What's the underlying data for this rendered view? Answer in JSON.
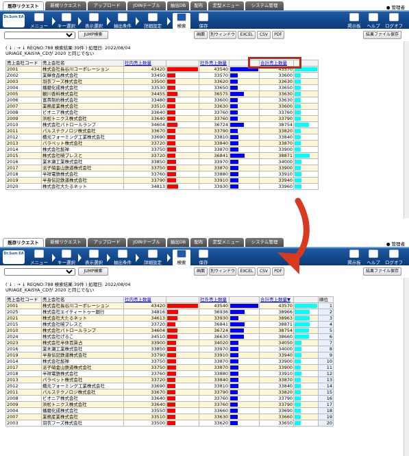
{
  "tabs": [
    "既存リクエスト",
    "新規リクエスト",
    "アップロード",
    "JOINテーブル",
    "抽出DB",
    "配布",
    "定型メニュー",
    "システム管理"
  ],
  "user": "管理者",
  "logo": "Dr.Sum EA",
  "toolbar": {
    "menu": "メニュー",
    "key_select": "キー選択",
    "display_select": "表示選択",
    "extract": "抽出条件",
    "detail": "詳細設定",
    "search": "検索",
    "save": "保存",
    "board": "掲示板",
    "help": "ヘルプ",
    "logoff": "ログオフ"
  },
  "buttons": {
    "jump": "JUMP検索",
    "screen": "画面",
    "new_window": "別ウィンドウ",
    "excel": "EXCEL",
    "csv": "CSV",
    "pdf": "PDF",
    "save_settings": "結果ファイル保存"
  },
  "panel1": {
    "info1": "( ↓ : → ↓ REQNO:788 検索結果:39件 ) 処理日: 2022/08/04",
    "info2": "URIAGE_KAISYA_CDが 2020 と同じでない",
    "headers": [
      "売上会社コード",
      "売上会社名",
      "社内売上数量",
      "",
      "社外売上数量",
      "",
      "合計売上数量",
      ""
    ],
    "rows": [
      [
        "2001",
        "株式会社長谷川コーポレーション",
        "43420",
        "43540",
        "43570"
      ],
      [
        "Z002",
        "業輝食品株式会社",
        "33450",
        "33570",
        "33600"
      ],
      [
        "2003",
        "羽衣フーズ株式会社",
        "33500",
        "33620",
        "33630"
      ],
      [
        "2004",
        "播磨化成株式会社",
        "33530",
        "33650",
        "33650"
      ],
      [
        "2005",
        "観川香料株式会社",
        "34455",
        "36575",
        "33630"
      ],
      [
        "2006",
        "富貴制約株式会社",
        "33480",
        "33600",
        "33630"
      ],
      [
        "2007",
        "業務産業株式会社",
        "33510",
        "33630",
        "33600"
      ],
      [
        "2008",
        "ビオニア株式会社",
        "33640",
        "33760",
        "33760"
      ],
      [
        "2009",
        "浜松トニクス株式会社",
        "33640",
        "33760",
        "33790"
      ],
      [
        "2010",
        "株式会社パトロールランプ",
        "34604",
        "36724",
        "38754"
      ],
      [
        "2011",
        "パルステクノロジ株式会社",
        "33670",
        "33790",
        "33820"
      ],
      [
        "2012",
        "橋元フォーミング工業株式会社",
        "33690",
        "33810",
        "33840"
      ],
      [
        "2013",
        "パラペット株式会社",
        "33720",
        "33840",
        "33870"
      ],
      [
        "2014",
        "株式会社髭禅",
        "33750",
        "33870",
        "33900"
      ],
      [
        "2015",
        "株式会社暁プレスと",
        "33720",
        "36841",
        "38871"
      ],
      [
        "2016",
        "業木瀬工業株式会社",
        "33850",
        "33970",
        "34000"
      ],
      [
        "2017",
        "派子硝金山鉄道株式会社",
        "33750",
        "33870",
        "33900"
      ],
      [
        "2018",
        "半祥電鉄株式会社",
        "33760",
        "33880",
        "33910"
      ],
      [
        "2019",
        "半身伝記鉄道株式会社",
        "33790",
        "33910",
        "33940"
      ],
      [
        "2020",
        "株式会社大たるネット",
        "34813",
        "33930",
        "33960"
      ]
    ]
  },
  "panel2": {
    "info1": "( ↓ : → ↓ REQNO:788 検索結果:39件 ) 処理日: 2022/08/04",
    "info2": "URIAGE_KAISYA_CDが 2020 と同じでない",
    "headers": [
      "売上会社コード",
      "売上会社名",
      "社内売上数量",
      "",
      "社外売上数量",
      "",
      "合計売上数量▼",
      "",
      "順位"
    ],
    "rows": [
      [
        "2001",
        "株式会社長谷川コーポレーション",
        "43420",
        "43540",
        "43570",
        "1"
      ],
      [
        "2025",
        "株式会社エイティートゥー銀行",
        "34816",
        "36936",
        "38966",
        "2"
      ],
      [
        "2021",
        "株式会社大たるネット",
        "34613",
        "33930",
        "38963",
        "3"
      ],
      [
        "2015",
        "株式会社暁プレスと",
        "33720",
        "36841",
        "38871",
        "4"
      ],
      [
        "2010",
        "株式会社パトロールランプ",
        "34604",
        "36724",
        "38754",
        "5"
      ],
      [
        "2024",
        "株式会社げるこ",
        "34510",
        "36630",
        "38660",
        "6"
      ],
      [
        "2023",
        "株式会社半休百貨占",
        "33900",
        "34020",
        "34050",
        "7"
      ],
      [
        "2016",
        "業木瀬工業株式会社",
        "33850",
        "33970",
        "34000",
        "8"
      ],
      [
        "2019",
        "半身伝記鉄道株式会社",
        "33790",
        "33910",
        "33940",
        "9"
      ],
      [
        "2014",
        "株式会社髭禅",
        "33750",
        "33870",
        "33900",
        "10"
      ],
      [
        "2017",
        "派子硝金山鉄道株式会社",
        "33750",
        "33870",
        "33900",
        "11"
      ],
      [
        "2018",
        "半祥電鉄株式会社",
        "33760",
        "33880",
        "33910",
        "12"
      ],
      [
        "2013",
        "パラペット株式会社",
        "33720",
        "33840",
        "33870",
        "13"
      ],
      [
        "2012",
        "橋元フォーミング工業株式会社",
        "33690",
        "33810",
        "33840",
        "14"
      ],
      [
        "2011",
        "パルステクノロジ株式会社",
        "33670",
        "33790",
        "33820",
        "15"
      ],
      [
        "2008",
        "ビオニア株式会社",
        "33640",
        "33760",
        "33790",
        "16"
      ],
      [
        "2009",
        "浜松トニクス株式会社",
        "33640",
        "33760",
        "33790",
        "17"
      ],
      [
        "2004",
        "播磨化成株式会社",
        "33550",
        "33660",
        "33690",
        "18"
      ],
      [
        "2007",
        "業務産業株式会社",
        "33510",
        "33630",
        "33660",
        "19"
      ],
      [
        "2003",
        "羽衣フーズ株式会社",
        "33500",
        "33620",
        "33650",
        "20"
      ]
    ]
  },
  "colors": {
    "bar_internal": "#ff0000",
    "bar_external": "#0000ff",
    "bar_total": "#00ffff",
    "highlight": "#b52a1a"
  }
}
